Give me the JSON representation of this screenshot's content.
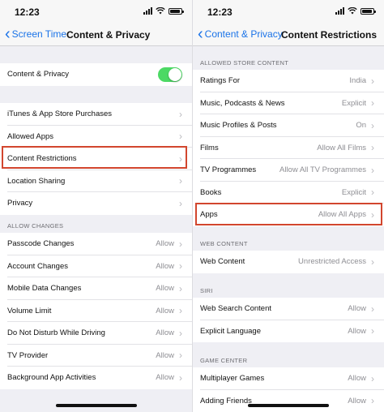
{
  "left": {
    "time": "12:23",
    "back_label": "Screen Time",
    "title": "Content & Privacy",
    "toggle_row": {
      "label": "Content & Privacy"
    },
    "group1": [
      {
        "label": "iTunes & App Store Purchases"
      },
      {
        "label": "Allowed Apps"
      },
      {
        "label": "Content Restrictions"
      },
      {
        "label": "Location Sharing"
      },
      {
        "label": "Privacy"
      }
    ],
    "allow_header": "ALLOW CHANGES",
    "allow_rows": [
      {
        "label": "Passcode Changes",
        "value": "Allow"
      },
      {
        "label": "Account Changes",
        "value": "Allow"
      },
      {
        "label": "Mobile Data Changes",
        "value": "Allow"
      },
      {
        "label": "Volume Limit",
        "value": "Allow"
      },
      {
        "label": "Do Not Disturb While Driving",
        "value": "Allow"
      },
      {
        "label": "TV Provider",
        "value": "Allow"
      },
      {
        "label": "Background App Activities",
        "value": "Allow"
      }
    ]
  },
  "right": {
    "time": "12:23",
    "back_label": "Content & Privacy",
    "title": "Content Restrictions",
    "store_header": "ALLOWED STORE CONTENT",
    "store_rows": [
      {
        "label": "Ratings For",
        "value": "India"
      },
      {
        "label": "Music, Podcasts & News",
        "value": "Explicit"
      },
      {
        "label": "Music Profiles & Posts",
        "value": "On"
      },
      {
        "label": "Films",
        "value": "Allow All Films"
      },
      {
        "label": "TV Programmes",
        "value": "Allow All TV Programmes"
      },
      {
        "label": "Books",
        "value": "Explicit"
      },
      {
        "label": "Apps",
        "value": "Allow All Apps"
      }
    ],
    "web_header": "WEB CONTENT",
    "web_rows": [
      {
        "label": "Web Content",
        "value": "Unrestricted Access"
      }
    ],
    "siri_header": "SIRI",
    "siri_rows": [
      {
        "label": "Web Search Content",
        "value": "Allow"
      },
      {
        "label": "Explicit Language",
        "value": "Allow"
      }
    ],
    "game_header": "GAME CENTER",
    "game_rows": [
      {
        "label": "Multiplayer Games",
        "value": "Allow"
      },
      {
        "label": "Adding Friends",
        "value": "Allow"
      }
    ]
  },
  "colors": {
    "accent": "#1a73e8",
    "toggle_on": "#4cd964",
    "highlight": "#d2462e"
  },
  "icons": {
    "back": "chevron-left-icon",
    "disclosure": "chevron-right-icon"
  }
}
